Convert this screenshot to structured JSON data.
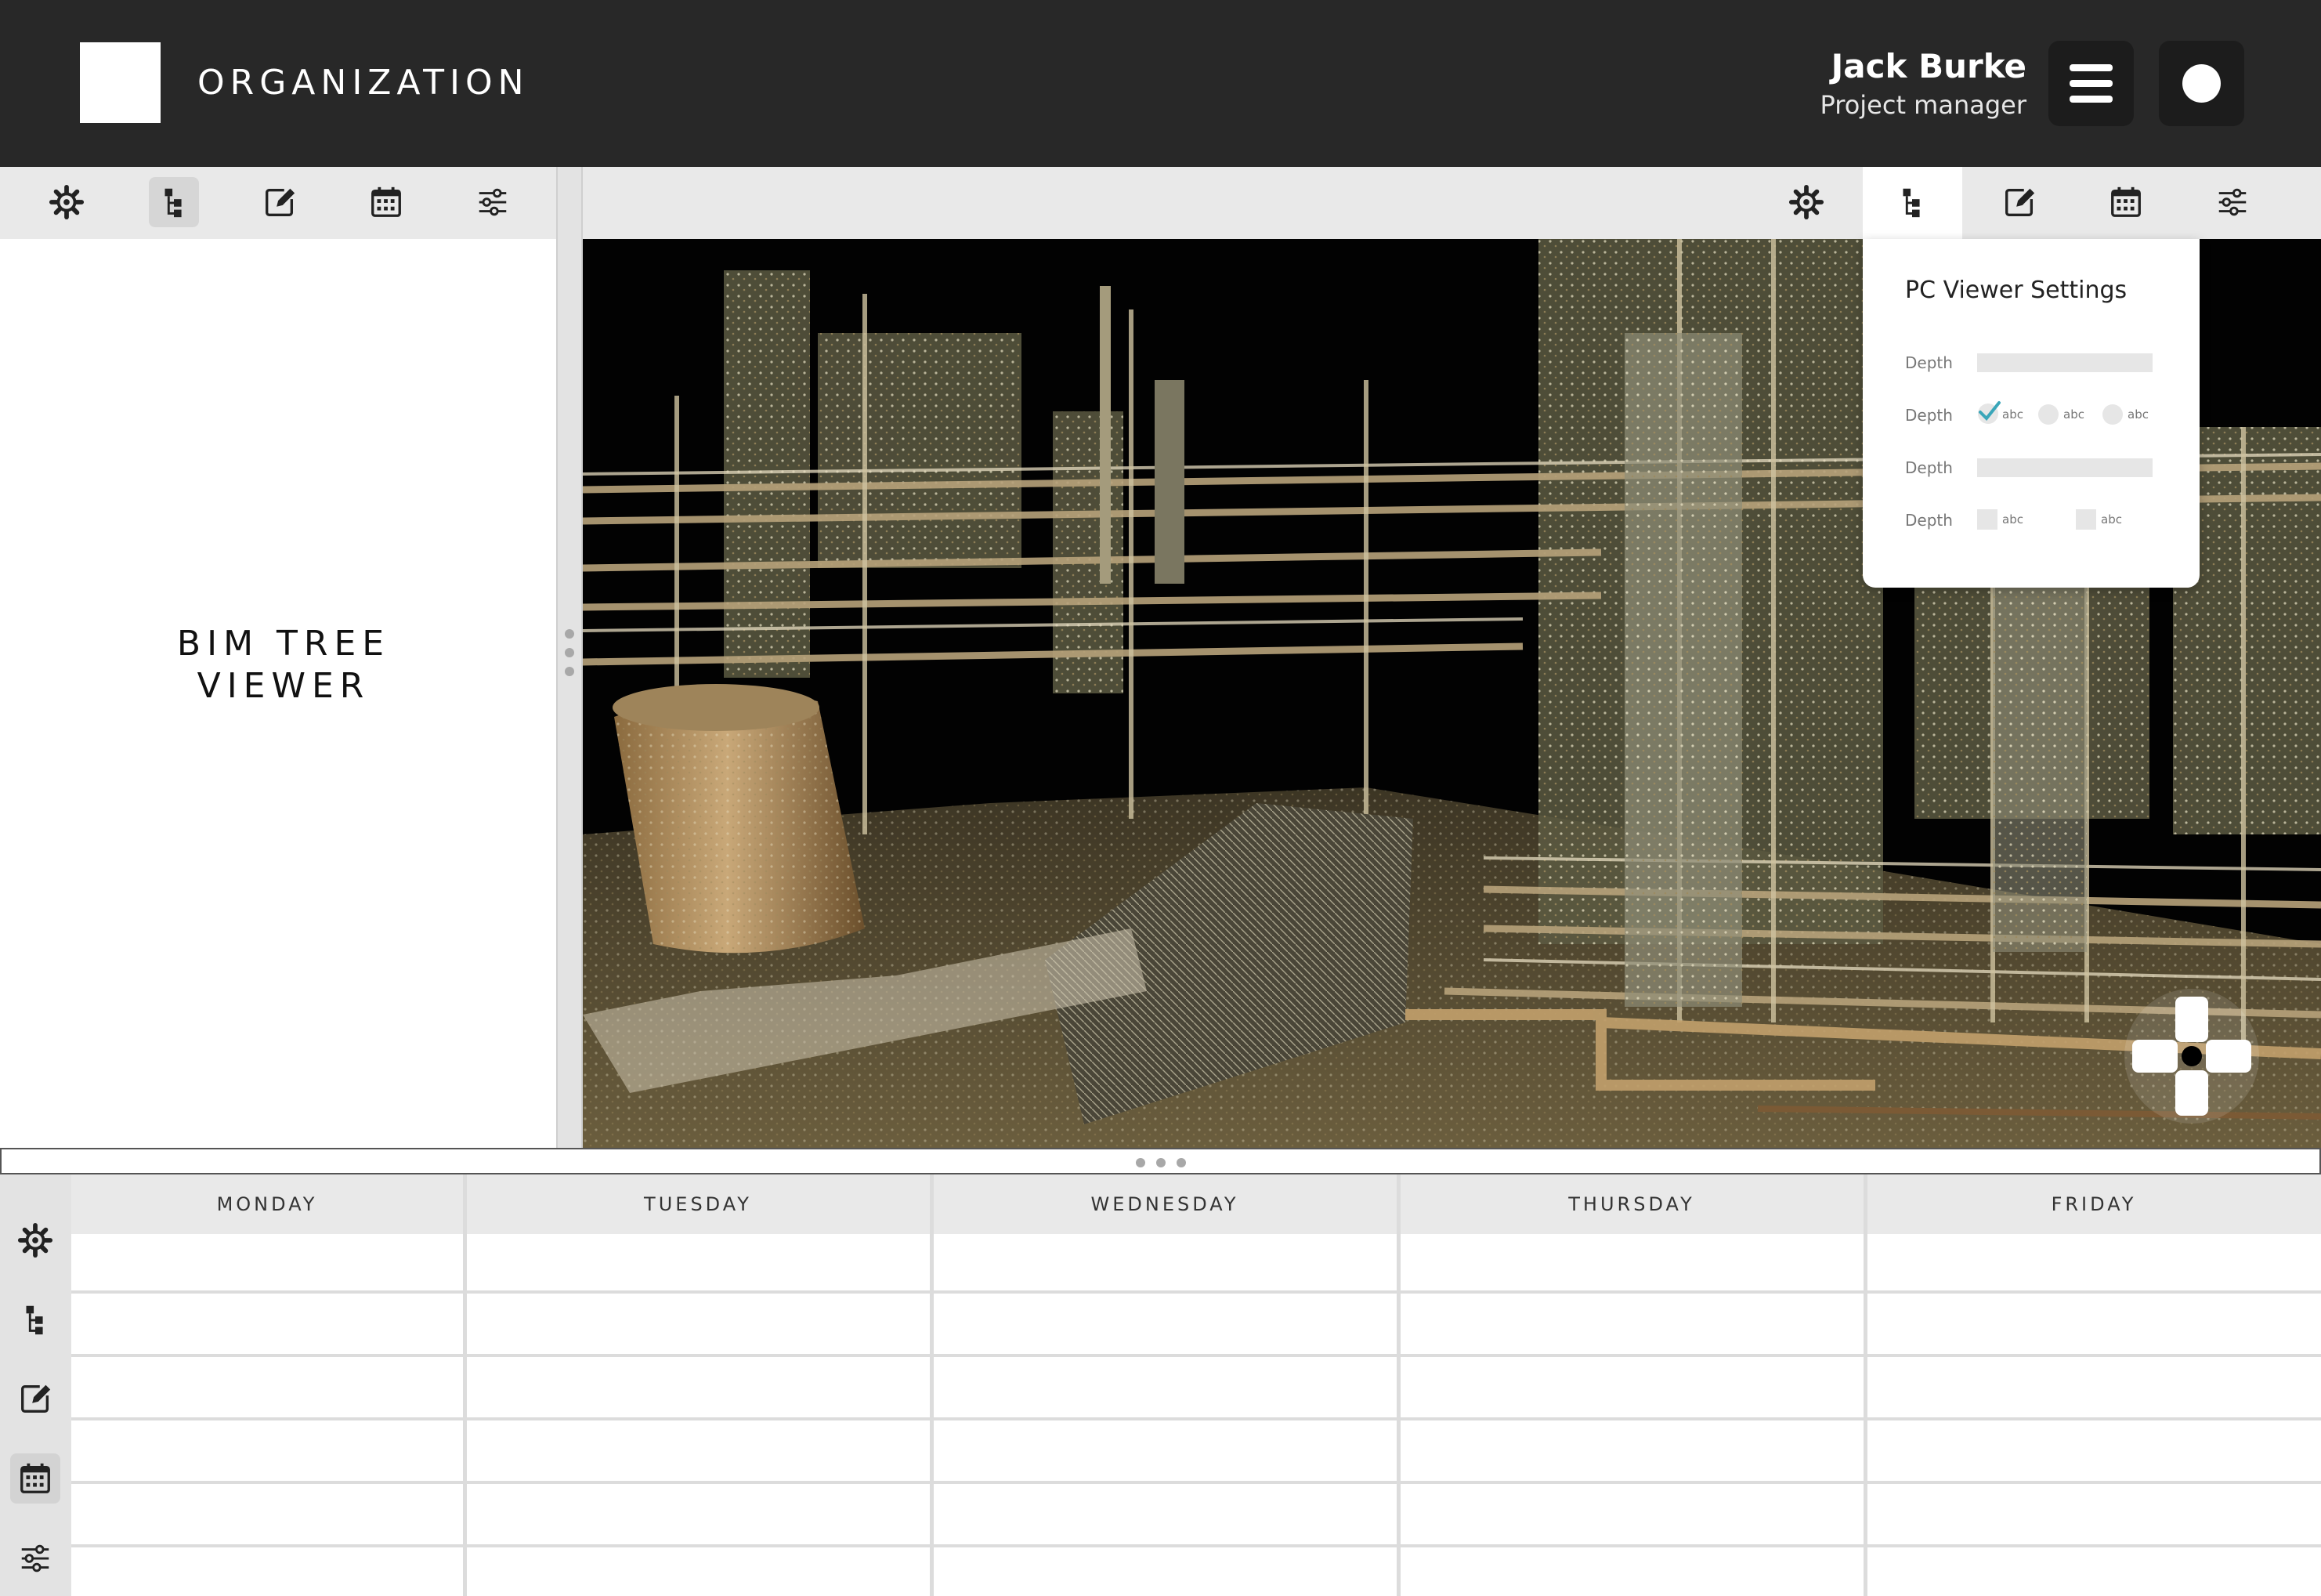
{
  "header": {
    "org_name": "ORGANIZATION",
    "user_name": "Jack Burke",
    "user_role": "Project manager",
    "menu_icon": "hamburger-menu-icon",
    "profile_icon": "profile-dot-icon"
  },
  "toolbar": {
    "buttons": [
      "settings-gear-icon",
      "tree-hierarchy-icon",
      "edit-note-icon",
      "calendar-icon",
      "sliders-icon"
    ],
    "left_active": "tree-hierarchy-icon",
    "right_active": "tree-hierarchy-icon"
  },
  "left_panel": {
    "title_line1": "BIM TREE",
    "title_line2": "VIEWER"
  },
  "settings_popover": {
    "title": "PC Viewer Settings",
    "rows": [
      {
        "label": "Depth",
        "type": "slider"
      },
      {
        "label": "Depth",
        "type": "radio",
        "options": [
          {
            "label": "abc",
            "checked": true
          },
          {
            "label": "abc",
            "checked": false
          },
          {
            "label": "abc",
            "checked": false
          }
        ]
      },
      {
        "label": "Depth",
        "type": "slider"
      },
      {
        "label": "Depth",
        "type": "checkbox",
        "options": [
          {
            "label": "abc",
            "checked": false
          },
          {
            "label": "abc",
            "checked": false
          }
        ]
      }
    ]
  },
  "calendar": {
    "days": [
      "MONDAY",
      "TUESDAY",
      "WEDNESDAY",
      "THURSDAY",
      "FRIDAY"
    ]
  },
  "colors": {
    "header_bg": "#282828",
    "toolbar_bg": "#e9e9e9",
    "accent_check": "#3aa6b9"
  }
}
